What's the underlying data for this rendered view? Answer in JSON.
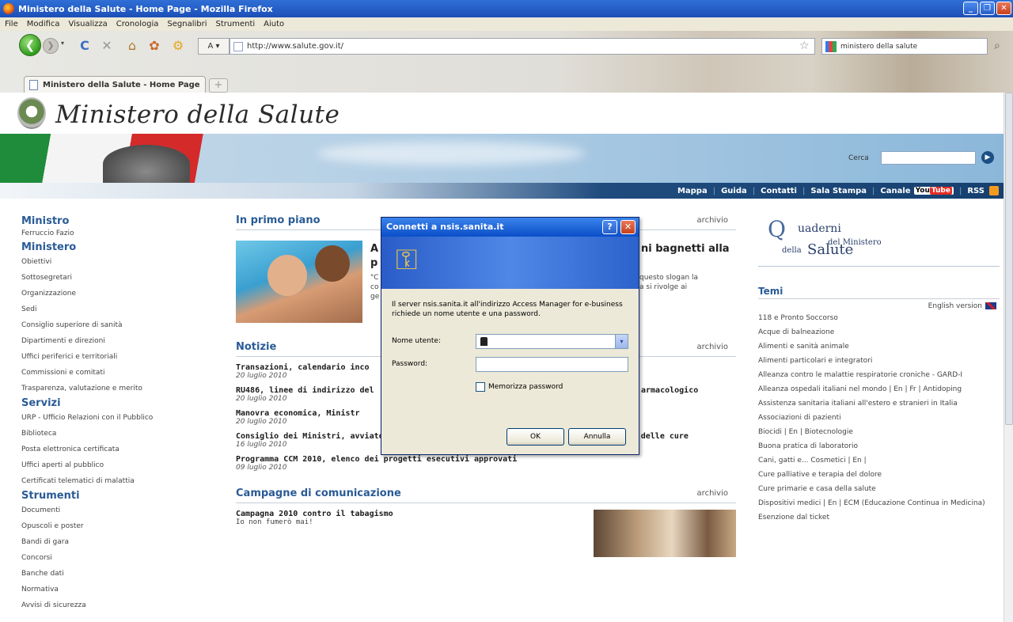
{
  "window": {
    "title": "Ministero della Salute - Home Page - Mozilla Firefox",
    "controls": [
      "_",
      "❐",
      "✕"
    ]
  },
  "menu": [
    "File",
    "Modifica",
    "Visualizza",
    "Cronologia",
    "Segnalibri",
    "Strumenti",
    "Aiuto"
  ],
  "toolbar": {
    "back": "❮",
    "forward": "❯",
    "dropdown": "▾",
    "reload": "C",
    "stop": "✕",
    "home": "⌂",
    "zoom_label": "A ▾",
    "url": "http://www.salute.gov.it/",
    "search_text": "ministero della salute",
    "star": "☆",
    "search_mag": "⌕"
  },
  "tab": {
    "title": "Ministero della Salute - Home Page",
    "new_tab": "+"
  },
  "site": {
    "title": "Ministero della Salute",
    "search_label": "Cerca",
    "search_go": "▶"
  },
  "topnav": [
    {
      "label": "Mappa"
    },
    {
      "label": "Guida"
    },
    {
      "label": "Contatti"
    },
    {
      "label": "Sala Stampa"
    },
    {
      "label": "Canale"
    },
    {
      "label": "RSS"
    }
  ],
  "youtube": {
    "you": "You",
    "tube": "Tube"
  },
  "sidebar": {
    "ministro_head": "Ministro",
    "ministro_name": "Ferruccio Fazio",
    "ministero_head": "Ministero",
    "ministero_items": [
      "Obiettivi",
      "Sottosegretari",
      "Organizzazione",
      "Sedi",
      "Consiglio superiore di sanità",
      "Dipartimenti e direzioni",
      "Uffici periferici e territoriali",
      "Commissioni e comitati",
      "Trasparenza, valutazione e merito"
    ],
    "servizi_head": "Servizi",
    "servizi_items": [
      "URP - Ufficio Relazioni con il Pubblico",
      "Biblioteca",
      "Posta elettronica certificata",
      "Uffici aperti al pubblico",
      "Certificati telematici di malattia"
    ],
    "strumenti_head": "Strumenti",
    "strumenti_items": [
      "Documenti",
      "Opuscoli e poster",
      "Bandi di gara",
      "Concorsi",
      "Banche dati",
      "Normativa",
      "Avvisi di sicurezza"
    ]
  },
  "primo_piano": {
    "title": "In primo piano",
    "archive": "archivio",
    "headline_a": "A",
    "headline_end": "ni bagnetti alla",
    "headline_p": "p",
    "desc_left": "\"C",
    "desc_right": "questo slogan la",
    "desc_left2": "co",
    "desc_right2": "a si rivolge ai",
    "desc_left3": "ge"
  },
  "notizie": {
    "title": "Notizie",
    "archive": "archivio",
    "items": [
      {
        "title": "Transazioni, calendario inco",
        "date": "20 luglio 2010"
      },
      {
        "title": "RU486, linee di indirizzo del",
        "title_end": "armacologico",
        "date": "20 luglio 2010"
      },
      {
        "title": "Manovra economica, Ministr",
        "date": "20 luglio 2010"
      },
      {
        "title": "Consiglio dei Ministri, avviato esame disegno di legge del Ministro Fazio su qualità delle cure",
        "date": "16 luglio 2010"
      },
      {
        "title": "Programma CCM 2010, elenco dei progetti esecutivi approvati",
        "date": "09 luglio 2010"
      }
    ]
  },
  "campagne": {
    "title": "Campagne di comunicazione",
    "archive": "archivio",
    "item_title": "Campagna 2010 contro il tabagismo",
    "item_sub": "Io non fumerò mai!"
  },
  "right": {
    "q_Q": "Q",
    "q_uaderni": "uaderni",
    "q_del": "del Ministero",
    "q_della": "della",
    "q_salute": "Salute",
    "temi_head": "Temi",
    "english": "English version",
    "temi": [
      "118 e Pronto Soccorso",
      "Acque di balneazione",
      "Alimenti e sanità animale",
      "Alimenti particolari e integratori",
      "Alleanza contro le malattie respiratorie croniche - GARD-I",
      "Alleanza ospedali italiani nel mondo | En | Fr | Antidoping",
      "Assistenza sanitaria italiani all'estero e stranieri in Italia",
      "Associazioni di pazienti",
      "Biocidi | En | Biotecnologie",
      "Buona pratica di laboratorio",
      "Cani, gatti e... Cosmetici | En |",
      "Cure palliative e terapia del dolore",
      "Cure primarie e casa della salute",
      "Dispositivi medici | En | ECM (Educazione Continua in Medicina)",
      "Esenzione dal ticket"
    ]
  },
  "dialog": {
    "title": "Connetti a nsis.sanita.it",
    "help": "?",
    "close": "✕",
    "keys_icon": "⚿",
    "message": "Il server nsis.sanita.it all'indirizzo Access Manager for e-business richiede un nome utente e una password.",
    "user_label": "Nome utente:",
    "pass_label": "Password:",
    "dropdown": "▾",
    "remember": "Memorizza password",
    "ok": "OK",
    "cancel": "Annulla"
  }
}
